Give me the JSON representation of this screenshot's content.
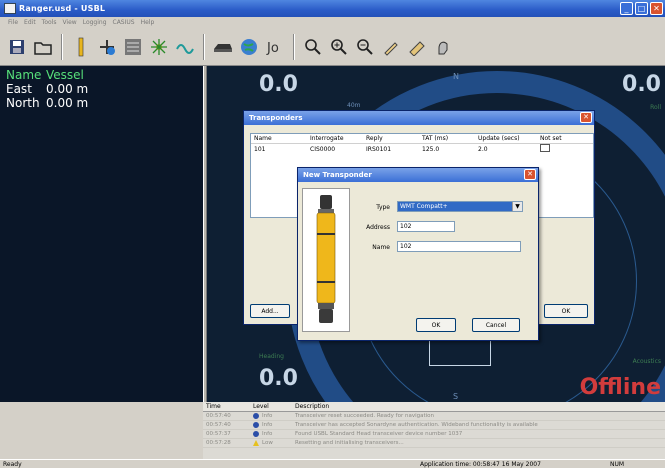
{
  "window": {
    "title": "Ranger.usd - USBL",
    "controls": {
      "minimize": "_",
      "maximize": "□",
      "close": "✕"
    }
  },
  "menu": [
    "File",
    "Edit",
    "Tools",
    "View",
    "Logging",
    "CASIUS",
    "Help"
  ],
  "toolbar_icons": [
    "save-icon",
    "open-icon",
    "transceiver-icon",
    "add-transponder-icon",
    "calibrate-icon",
    "survey-icon",
    "sound-velocity-icon",
    "vessel-icon",
    "globe-icon",
    "marks-icon",
    "zoom-tool-icon",
    "zoom-in-icon",
    "zoom-out-icon",
    "pen-icon",
    "ruler-icon",
    "pan-icon"
  ],
  "left_panel": {
    "rows": [
      {
        "key": "Name",
        "value": "Vessel"
      },
      {
        "key": "East",
        "value": "0.00 m"
      },
      {
        "key": "North",
        "value": "0.00 m"
      }
    ]
  },
  "nav": {
    "top_left": "0.0",
    "top_right": "0.0",
    "bottom_left": "0.0",
    "status": "Offline",
    "compass_n": "N",
    "compass_s": "S",
    "heading_label": "Heading",
    "roll_label": "Roll",
    "acoustics_label": "Acoustics",
    "ring_label": "40m"
  },
  "colors": {
    "panel_bg": "#0a1628",
    "ring": "#214c86",
    "offline": "#d23c3c",
    "title_bar": "#2a5bc7"
  },
  "log": {
    "headers": [
      "Time",
      "Level",
      "Description"
    ],
    "rows": [
      {
        "time": "00:57:40",
        "level": "Info",
        "desc": "Transceiver reset succeeded. Ready for navigation"
      },
      {
        "time": "00:57:40",
        "level": "Info",
        "desc": "Transceiver has accepted Sonardyne authentication. Wideband functionality is available"
      },
      {
        "time": "00:57:37",
        "level": "Info",
        "desc": "Found USBL Standard Head transceiver device number 1037"
      },
      {
        "time": "00:57:28",
        "level": "Low",
        "desc": "Resetting and initialising transceivers..."
      }
    ]
  },
  "statusbar": {
    "left": "Ready",
    "app_time": "Application time: 00:58:47 16 May 2007",
    "num": "NUM"
  },
  "transponders_dialog": {
    "title": "Transponders",
    "columns": [
      "Name",
      "Interrogate",
      "Reply",
      "TAT (ms)",
      "Update (secs)",
      "Not set"
    ],
    "rows": [
      {
        "name": "101",
        "interrogate": "CIS0000",
        "reply": "IRS0101",
        "tat": "125.0",
        "update": "2.0",
        "not_set": ""
      }
    ],
    "add_label": "Add...",
    "ok_label": "OK"
  },
  "new_transponder_dialog": {
    "title": "New Transponder",
    "type_label": "Type",
    "type_value": "WMT Compatt+",
    "address_label": "Address",
    "address_value": "102",
    "name_label": "Name",
    "name_value": "102",
    "ok_label": "OK",
    "cancel_label": "Cancel"
  }
}
